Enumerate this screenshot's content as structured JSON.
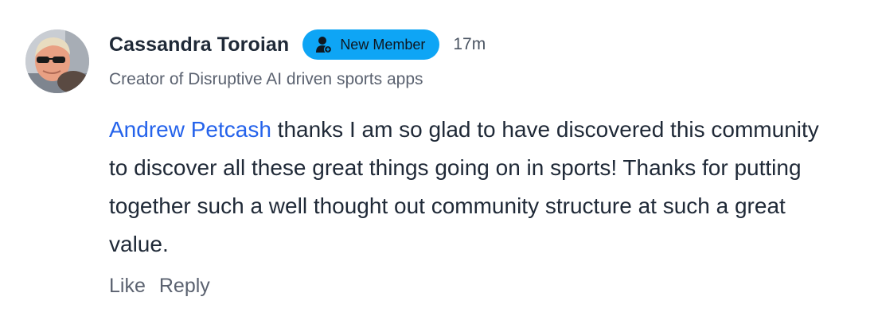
{
  "comment": {
    "author": "Cassandra Toroian",
    "badge": {
      "label": "New Member",
      "icon": "user-plus-icon",
      "color": "#0ea5f5"
    },
    "timestamp": "17m",
    "headline": "Creator of Disruptive AI driven sports apps",
    "mention": "Andrew Petcash",
    "text": " thanks I am so glad to have discovered this community to discover all these great things going on in sports! Thanks for putting together such a well thought out community structure at such a great value.",
    "actions": {
      "like_label": "Like",
      "reply_label": "Reply"
    },
    "mention_color": "#2563eb"
  }
}
